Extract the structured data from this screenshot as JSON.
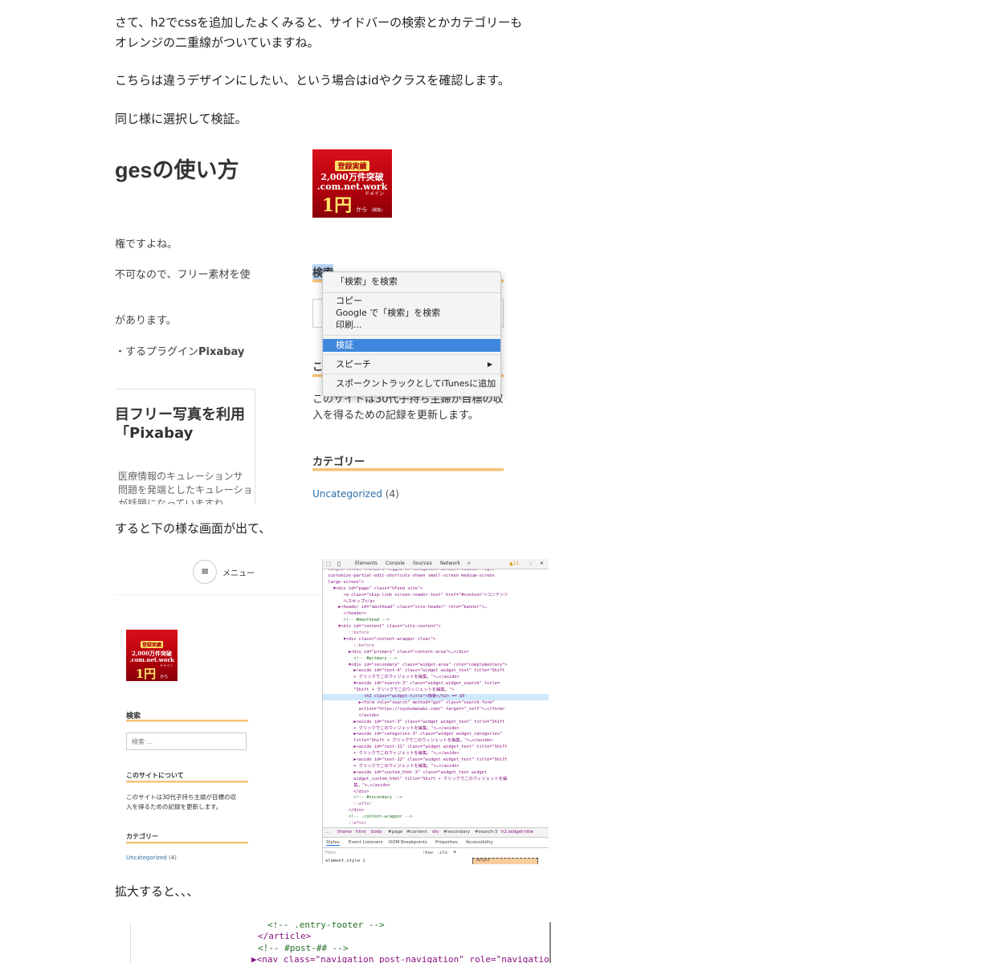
{
  "article": {
    "p1_line1": "さて、h2でcssを追加したよくみると、サイドバーの検索とかカテゴリーも",
    "p1_line2": "オレンジの二重線がついていますね。",
    "p2": "こちらは違うデザインにしたい、という場合はidやクラスを確認します。",
    "p3": "同じ様に選択して検証。",
    "p4": "すると下の様な画面が出て、",
    "p5": "拡大すると、、、"
  },
  "shot1": {
    "post_title": "gesの使い方",
    "text1": "権ですよね。",
    "text2": "不可なので、フリー素材を使",
    "text3": "があります。",
    "text4_prefix": "・するプラグイン",
    "text4_bold": "Pixabay",
    "card_title_1": "目フリー写真を利用",
    "card_title_2": "「Pixabay",
    "card_text_1": "医療情報のキュレーションサ",
    "card_text_2": "問題を発端としたキュレーショ",
    "card_text_3": "が話題になっていますね",
    "banner": {
      "line1": "登録実績",
      "line2": "2,000万件突破",
      "line3": ".com.net.work",
      "line4": "ドメイン",
      "line5": "1円",
      "line6": "から",
      "line7": "(税抜)"
    },
    "search_widget_title": "検索",
    "about_widget_title_partial": "こ",
    "about_text_1": "このサイトは30代子持ち主婦が目標の収",
    "about_text_2": "入を得るための記録を更新します。",
    "category_title": "カテゴリー",
    "category_link": "Uncategorized",
    "category_count": "(4)"
  },
  "context_menu": {
    "items": [
      "「検索」を検索",
      "コピー",
      "Google で「検索」を検索",
      "印刷...",
      "検証",
      "スピーチ",
      "スポークントラックとしてiTunesに追加"
    ],
    "selected": "検証",
    "submenu_arrow": "▶"
  },
  "shot2": {
    "menu_label": "メニュー",
    "menu_icon": "hamburger-icon",
    "search_title": "検索",
    "search_placeholder": "検索 ...",
    "about_title": "このサイトについて",
    "about_text_1": "このサイトは30代子持ち主婦が目標の収",
    "about_text_2": "入を得るための記録を更新します。",
    "category_title": "カテゴリー",
    "category_link": "Uncategorized",
    "category_count": "(4)",
    "devtools": {
      "tabs": [
        "Elements",
        "Console",
        "Sources",
        "Network",
        "»"
      ],
      "warning_count": "▲11",
      "more": "⋮",
      "close": "✕",
      "code_lines": [
        "  single-format-standard logged-in navigation-default sidebar-right",
        "  customize-partial-edit-shortcuts-shown small-screen medium-screen",
        "  large-screen\">",
        "    ▼<div id=\"page\" class=\"hfeed site\">",
        "        <a class=\"skip-link screen-reader-text\" href=\"#content\">コンテンツ",
        "        へスキップ</a>",
        "      ▶<header id=\"masthead\" class=\"site-header\" role=\"banner\">…",
        "        </header>",
        "        <!-- #masthead -->",
        "      ▼<div id=\"content\" class=\"site-content\">",
        "          ::before",
        "        ▼<div class=\"content-wrapper clear\">",
        "            ::before",
        "          ▶<div id=\"primary\" class=\"content-area\">…</div>",
        "            <!-- #primary -->",
        "          ▼<div id=\"secondary\" class=\"widget-area\" role=\"complementary\">",
        "            ▶<aside id=\"text-4\" class=\"widget widget_text\" title=\"Shift",
        "            + クリックでこのウィジェットを編集。\">…</aside>",
        "            ▼<aside id=\"search-3\" class=\"widget widget_search\" title=",
        "            \"Shift + クリックでこのウィジェットを編集。\">",
        "                <h2 class=\"widget-title\">検索</h2> == $0",
        "              ▶<form role=\"search\" method=\"get\" class=\"search-form\"",
        "              action=\"https://syuhumanabi.com/\" target=\"_self\">…</form>",
        "              </aside>",
        "            ▶<aside id=\"text-3\" class=\"widget widget_text\" title=\"Shift",
        "            + クリックでこのウィジェットを編集。\">…</aside>",
        "            ▶<aside id=\"categories-3\" class=\"widget widget_categories\"",
        "            title=\"Shift + クリックでこのウィジェットを編集。\">…</aside>",
        "            ▶<aside id=\"text-11\" class=\"widget widget_text\" title=\"Shift",
        "            + クリックでこのウィジェットを編集。\">…</aside>",
        "            ▶<aside id=\"text-12\" class=\"widget widget_text\" title=\"Shift",
        "            + クリックでこのウィジェットを編集。\">…</aside>",
        "            ▶<aside id=\"custom_html-3\" class=\"widget_text widget",
        "            widget_custom_html\" title=\"Shift + クリックでこのウィジェットを編",
        "            集。\">…</aside>",
        "            </div>",
        "            <!-- #secondary -->",
        "            ::after",
        "          </div>",
        "          <!-- .content-wrapper -->",
        "          ::after"
      ],
      "breadcrumb": [
        "...",
        "iframe",
        "html",
        "body",
        "#page",
        "#content",
        "div",
        "#secondary",
        "#search-3",
        "h2.widget-title"
      ],
      "subtabs": [
        "Styles",
        "Event Listeners",
        "DOM Breakpoints",
        "Properties",
        "Accessibility"
      ],
      "filter_placeholder": "Filter",
      "hov": ":hov",
      "cls": ".cls",
      "plus": "+",
      "element_style": "element.style {",
      "margin_label": "margin"
    }
  },
  "shot3": {
    "lines": [
      "<!-- .entry-footer -->",
      "</article>",
      "<!-- #post-## -->",
      "▶<nav class=\"navigation post-navigation\" role=\"navigation\">"
    ]
  }
}
